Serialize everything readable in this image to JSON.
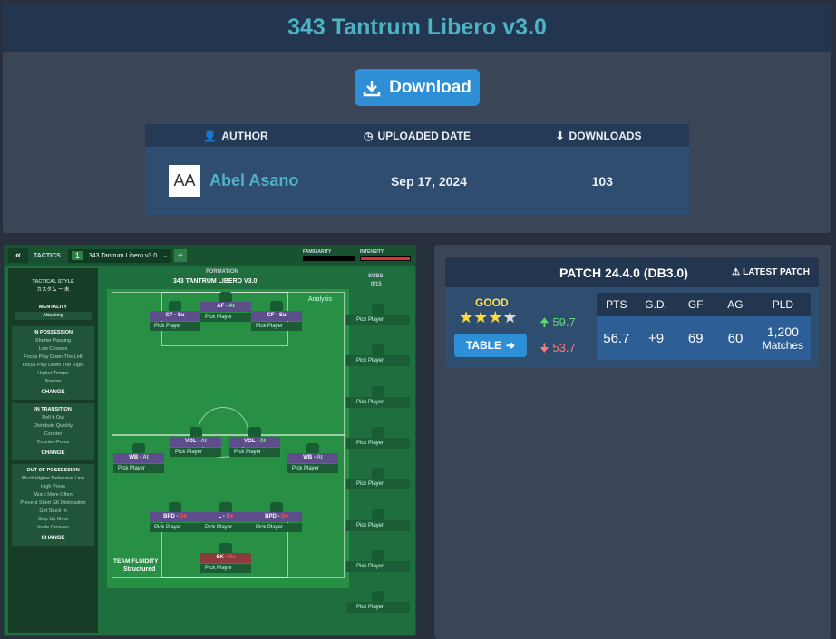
{
  "page_title": "343 Tantrum Libero v3.0",
  "download_label": "Download",
  "info": {
    "headers": {
      "author": "AUTHOR",
      "uploaded": "UPLOADED DATE",
      "downloads": "DOWNLOADS"
    },
    "avatar_initials": "AA",
    "author": "Abel Asano",
    "uploaded": "Sep 17, 2024",
    "downloads": "103"
  },
  "fm": {
    "tactics_label": "TACTICS",
    "tactic_number": "1",
    "tactic_name": "343 Tantrum Libero v3.0",
    "familiarity_label": "FAMILIARITY",
    "intensity_label": "INTENSITY",
    "tactical_style_label": "TACTICAL STYLE",
    "tactical_style_value": "カスタム ー 未",
    "mentality_label": "MENTALITY",
    "mentality_value": "Attacking",
    "in_possession": {
      "title": "IN POSSESSION",
      "items": [
        "Shorter Passing",
        "Low Crosses",
        "Focus Play Down The Left",
        "Focus Play Down The Right",
        "Higher Tempo",
        "Narrow"
      ]
    },
    "in_transition": {
      "title": "IN TRANSITION",
      "items": [
        "Roll It Out",
        "Distribute Quickly",
        "Counter",
        "Counter-Press"
      ]
    },
    "out_of_possession": {
      "title": "OUT OF POSSESSION",
      "items": [
        "Much Higher Defensive Line",
        "High Press",
        "Much More Often",
        "Prevent Short GK Distribution",
        "Get Stuck In",
        "Step Up More",
        "Invite Crosses"
      ]
    },
    "change_label": "CHANGE",
    "formation_label": "FORMATION",
    "formation_name": "343 TANTRUM LIBERO V3.0",
    "analysis_label": "Analysis",
    "subs_label": "SUBS:",
    "subs_count": "0/15",
    "pick_player": "Pick Player",
    "team_fluidity_label": "TEAM FLUIDITY",
    "team_fluidity_value": "Structured",
    "players": [
      {
        "role": "CF",
        "duty": "Su"
      },
      {
        "role": "AF",
        "duty": "At"
      },
      {
        "role": "CF",
        "duty": "Su"
      },
      {
        "role": "VOL",
        "duty": "At"
      },
      {
        "role": "VOL",
        "duty": "At"
      },
      {
        "role": "WB",
        "duty": "At"
      },
      {
        "role": "WB",
        "duty": "At"
      },
      {
        "role": "BPD",
        "duty": "De"
      },
      {
        "role": "L",
        "duty": "De"
      },
      {
        "role": "BPD",
        "duty": "De"
      },
      {
        "role": "SK",
        "duty": "De"
      }
    ]
  },
  "patch": {
    "title": "PATCH 24.4.0 (DB3.0)",
    "latest": "LATEST PATCH",
    "rating_label": "GOOD",
    "stars": 3,
    "max_stars": 4,
    "table_label": "TABLE",
    "up_value": "59.7",
    "down_value": "53.7",
    "stat_headers": [
      "PTS",
      "G.D.",
      "GF",
      "AG",
      "PLD"
    ],
    "stat_values": [
      "56.7",
      "+9",
      "69",
      "60"
    ],
    "pld_value": "1,200",
    "pld_unit": "Matches"
  },
  "colors": {
    "accent": "#4fb1c4",
    "button": "#2f8fd6",
    "pitch": "#289044"
  }
}
